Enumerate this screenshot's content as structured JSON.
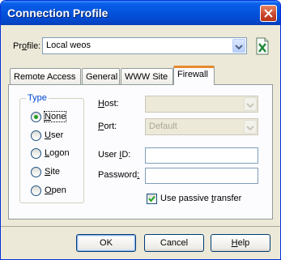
{
  "window": {
    "title": "Connection Profile"
  },
  "profile": {
    "label_prefix": "Pr",
    "label_underline": "o",
    "label_suffix": "file:",
    "value": "Local weos"
  },
  "tabs": [
    {
      "label": "Remote Access"
    },
    {
      "label": "General"
    },
    {
      "label": "WWW Site"
    },
    {
      "label": "Firewall"
    }
  ],
  "type_group": {
    "title": "Type",
    "options": [
      {
        "label": "None",
        "u": "N",
        "rest": "one",
        "selected": true
      },
      {
        "label": "User",
        "u": "U",
        "rest": "ser",
        "selected": false
      },
      {
        "label": "Logon",
        "u": "L",
        "rest": "ogon",
        "selected": false
      },
      {
        "label": "Site",
        "u": "S",
        "rest": "ite",
        "selected": false
      },
      {
        "label": "Open",
        "u": "O",
        "rest": "pen",
        "selected": false
      }
    ]
  },
  "fields": {
    "host": {
      "u": "H",
      "rest": "ost:",
      "value": ""
    },
    "port": {
      "u": "P",
      "rest": "ort:",
      "value": "Default"
    },
    "user_id": {
      "pre": "User ",
      "u": "I",
      "rest": "D:",
      "value": ""
    },
    "password": {
      "pre": "Password",
      "u": ":",
      "rest": "",
      "value": ""
    }
  },
  "passive": {
    "pre": "Use passive ",
    "u": "t",
    "rest": "ransfer",
    "checked": true
  },
  "buttons": {
    "ok": "OK",
    "cancel": "Cancel",
    "help_u": "H",
    "help_rest": "elp"
  },
  "colors": {
    "titlebar": "#0453dd",
    "dialog_bg": "#ece9d8",
    "tab_highlight": "#e68b2c",
    "accent_text": "#0046d5"
  }
}
